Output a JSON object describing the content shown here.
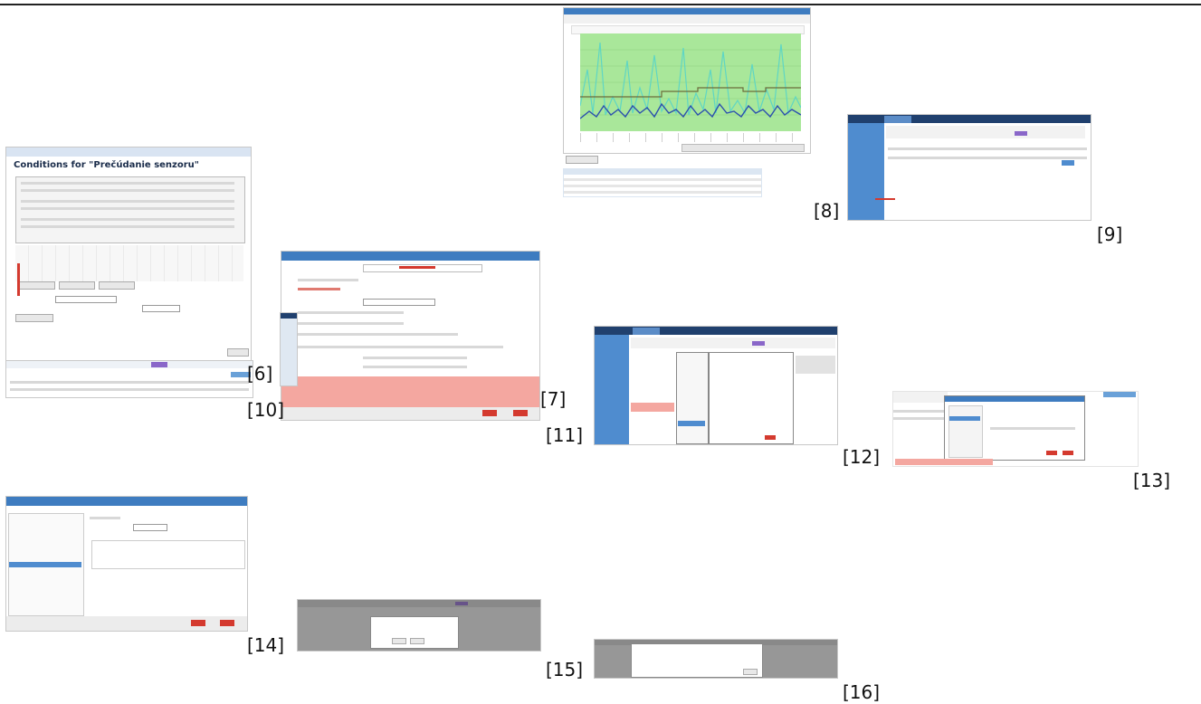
{
  "figure_labels": [
    "[6]",
    "[7]",
    "[8]",
    "[9]",
    "[10]",
    "[11]",
    "[12]",
    "[13]",
    "[14]",
    "[15]",
    "[16]"
  ],
  "shots": {
    "conditions_dialog": {
      "title": "Conditions for \"Prečúdanie senzoru\""
    }
  },
  "colors": {
    "titlebar": "#3e7cc0",
    "titlebar_dark": "#20406e",
    "chart_bg": "#a9e79a",
    "line_light": "#5fd6c4",
    "line_dark": "#2b4fae",
    "threshold": "#6b6b3b",
    "warning": "#f4a7a0"
  }
}
